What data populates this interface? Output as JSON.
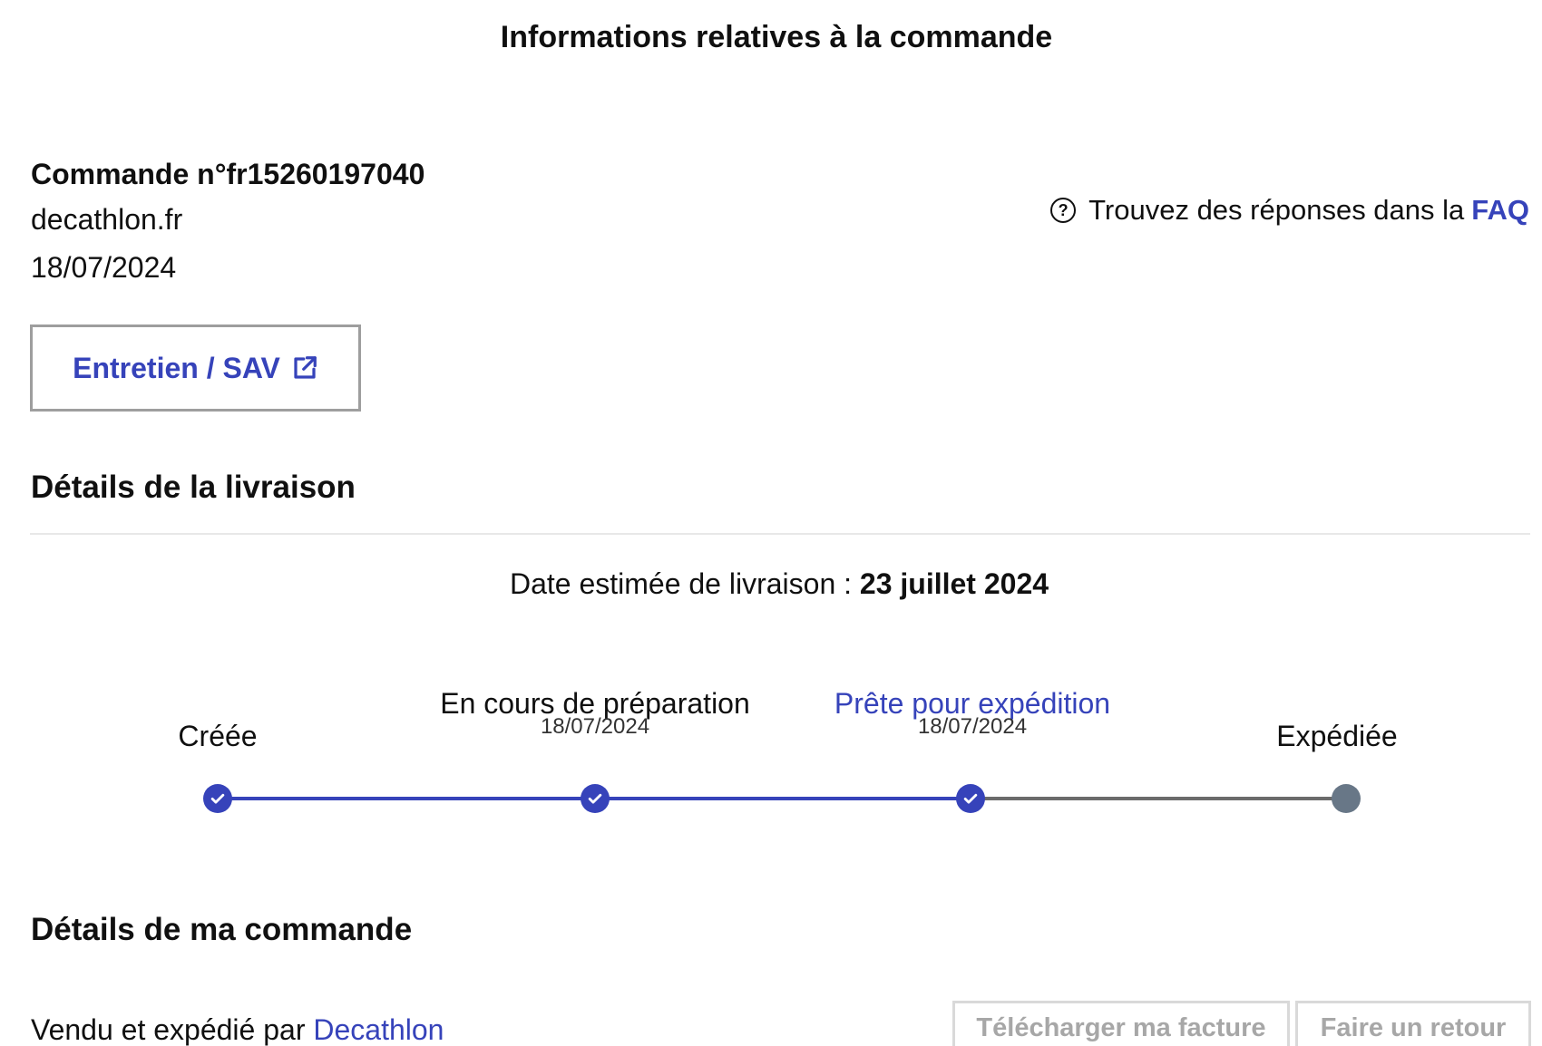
{
  "header": {
    "title": "Informations relatives à la commande"
  },
  "order": {
    "number": "Commande n°fr15260197040",
    "site": "decathlon.fr",
    "date": "18/07/2024",
    "sav_button": "Entretien / SAV"
  },
  "faq": {
    "text": "Trouvez des réponses dans la",
    "link": "FAQ"
  },
  "delivery": {
    "title": "Détails de la livraison",
    "estimated_label": "Date estimée de livraison :",
    "estimated_date": "23 juillet 2024",
    "steps": [
      {
        "label": "Créée",
        "date": "",
        "status": "done"
      },
      {
        "label": "En cours de préparation",
        "date": "18/07/2024",
        "status": "done"
      },
      {
        "label": "Prête pour expédition",
        "date": "18/07/2024",
        "status": "current"
      },
      {
        "label": "Expédiée",
        "date": "",
        "status": "pending"
      }
    ]
  },
  "order_details": {
    "title": "Détails de ma commande",
    "sold_by_prefix": "Vendu et expédié par",
    "seller": "Decathlon",
    "invoice_button": "Télécharger ma facture",
    "return_button": "Faire un retour"
  },
  "colors": {
    "accent": "#3643ba",
    "pending": "#687787",
    "disabled_text": "#a7a7a7"
  },
  "icons": {
    "faq": "question-circle-icon",
    "external": "external-link-icon",
    "check": "check-icon"
  }
}
